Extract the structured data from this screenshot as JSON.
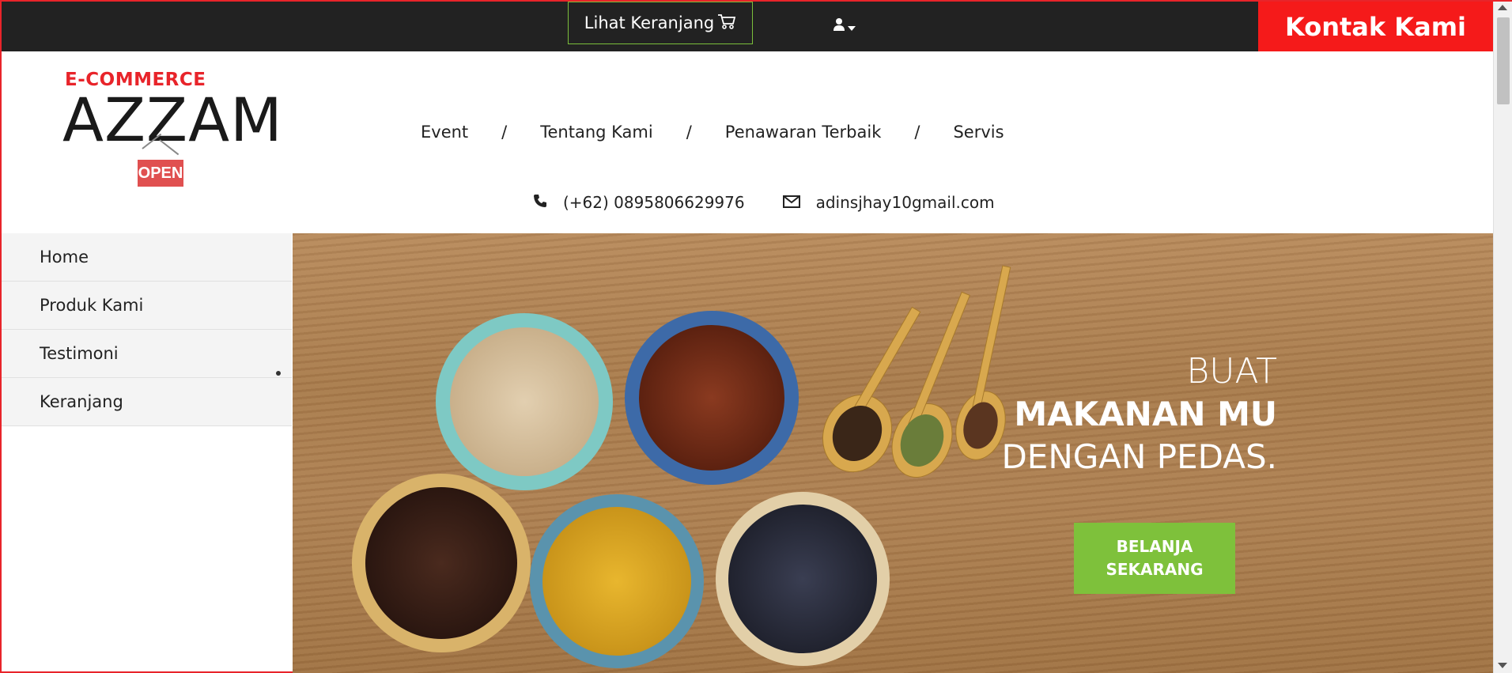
{
  "topbar": {
    "cart_label": "Lihat Keranjang",
    "cart_icon": "shopping-cart-icon",
    "user_icon": "user-icon",
    "dropdown_icon": "caret-down-icon",
    "contact_label": "Kontak Kami",
    "contact_color": "#f51a1a",
    "bar_color": "#222222"
  },
  "logo": {
    "small": "E-COMMERCE",
    "big": "AZZAM",
    "sign": "OPEN"
  },
  "nav": {
    "items": [
      "Event",
      "Tentang Kami",
      "Penawaran Terbaik",
      "Servis"
    ],
    "separator": "/"
  },
  "contact": {
    "phone_icon": "phone-icon",
    "phone": "(+62) 0895806629976",
    "email_icon": "envelope-icon",
    "email": "adinsjhay10gmail.com"
  },
  "sidebar": {
    "items": [
      "Home",
      "Produk Kami",
      "Testimoni",
      "Keranjang"
    ]
  },
  "hero": {
    "line1": "BUAT",
    "line2": "MAKANAN MU",
    "line3": "DENGAN PEDAS.",
    "button_line1": "BELANJA",
    "button_line2": "SEKARANG",
    "button_color": "#7ec13b"
  }
}
